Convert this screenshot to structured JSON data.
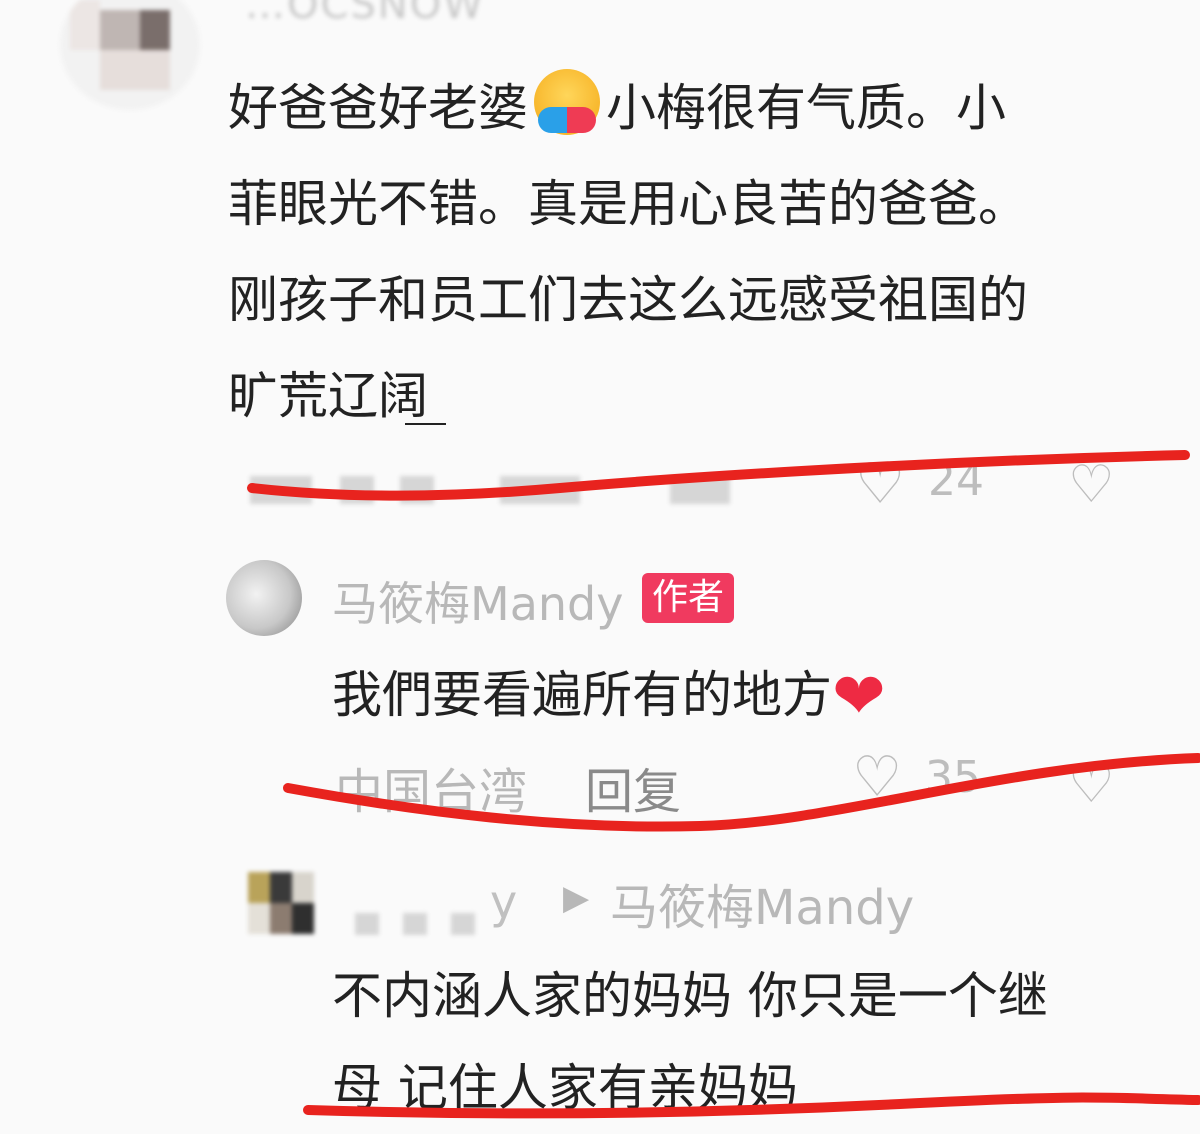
{
  "comment": {
    "username": "…OCSNOW",
    "line1": "好爸爸好老婆",
    "line1b": "小梅很有气质。小",
    "line2": "菲眼光不错。真是用心良苦的爸爸。",
    "line3": "刚孩子和员工们去这么远感受祖国的",
    "line4": "旷荒辽阔",
    "emoji": "hug-emoji",
    "likes": "24"
  },
  "author_reply": {
    "username": "马筱梅Mandy",
    "badge": "作者",
    "text": "我們要看遍所有的地方",
    "emoji": "heart-emoji",
    "region": "中国台湾",
    "reply_label": "回复",
    "likes": "35"
  },
  "sub_reply": {
    "username_tail": "y",
    "reply_to": "马筱梅Mandy",
    "line1": "不内涵人家的妈妈 你只是一个继",
    "line2": "母 记住人家有亲妈妈"
  },
  "colors": {
    "annotation": "#e8231e",
    "badge": "#f03a5f",
    "meta": "#b8b8b8"
  }
}
